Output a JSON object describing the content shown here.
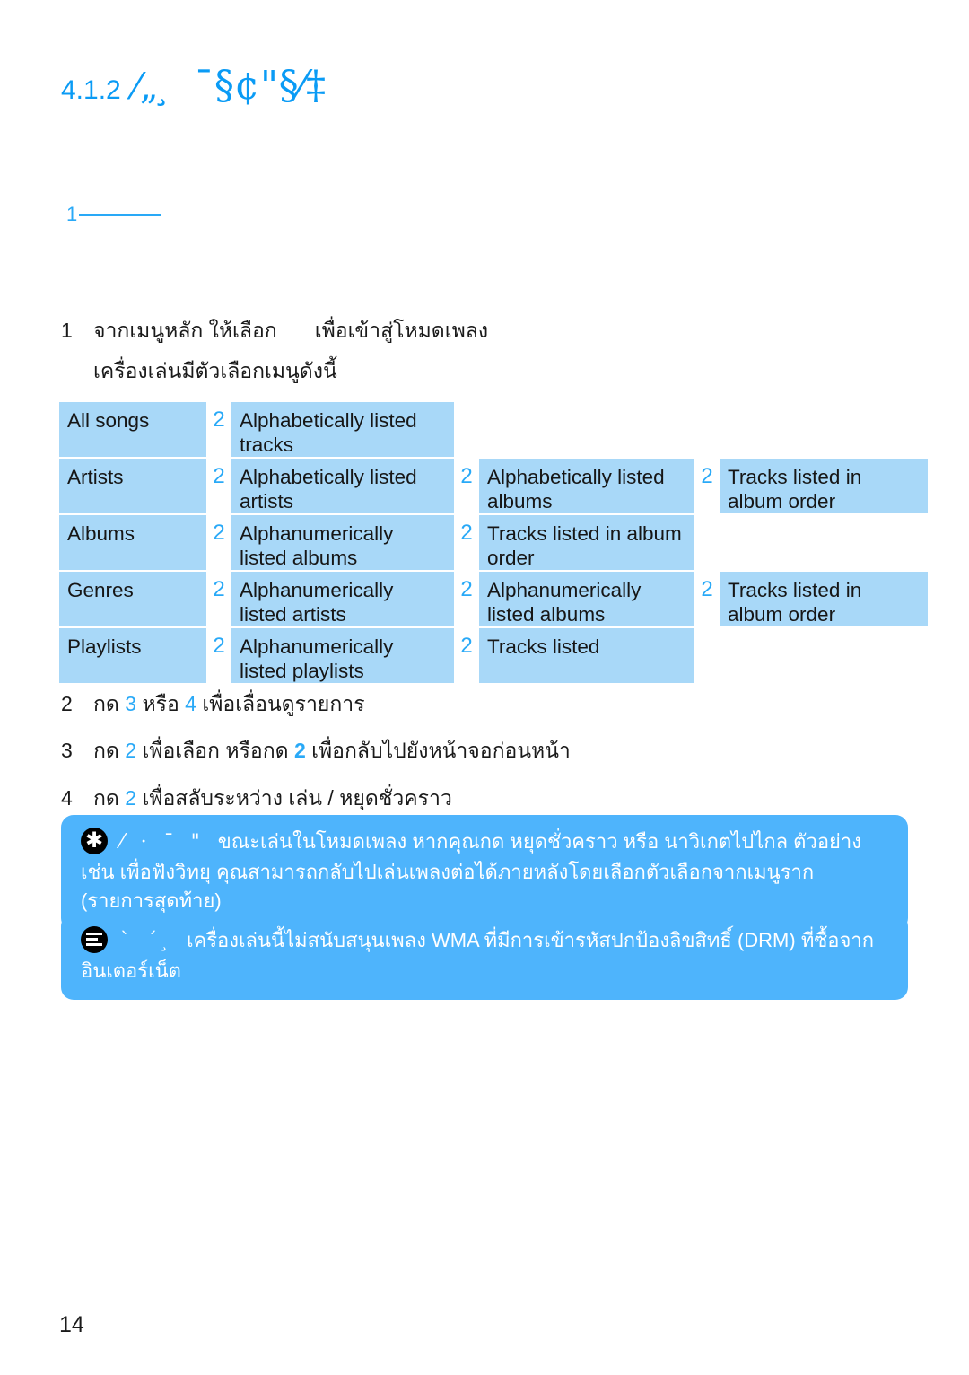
{
  "document": {
    "heading_number": "4.1.2",
    "heading_glyphs_1": "⁄„ ̧",
    "heading_glyphs_2": "¯§¢\"§⁄‡",
    "page_number": "14",
    "accent_blue": "#29a9f7",
    "cell_blue": "#a8d8f8",
    "notice_blue": "#4eb4fc"
  },
  "callout": {
    "number": "1"
  },
  "steps_top": [
    {
      "number": "1",
      "text_before": "จากเมนูหลัก ให้เลือก",
      "text_after": "เพื่อเข้าสู่โหมดเพลง"
    }
  ],
  "intro_line": "เครื่องเล่นมีตัวเลือกเมนูดังนี้",
  "menu_table": {
    "arrow_glyph": "2",
    "rows": [
      {
        "level1": "All songs",
        "level2": "Alphabetically listed tracks",
        "level3": "",
        "level4": ""
      },
      {
        "level1": "Artists",
        "level2": "Alphabetically listed artists",
        "level3": "Alphabetically listed albums",
        "level4": "Tracks listed in album order"
      },
      {
        "level1": "Albums",
        "level2": "Alphanumerically listed albums",
        "level3": "Tracks listed in album order",
        "level4": ""
      },
      {
        "level1": "Genres",
        "level2": "Alphanumerically listed artists",
        "level3": "Alphanumerically listed albums",
        "level4": "Tracks listed in album order"
      },
      {
        "level1": "Playlists",
        "level2": "Alphanumerically listed playlists",
        "level3": "Tracks listed",
        "level4": ""
      }
    ]
  },
  "steps_bottom": [
    {
      "number": "2",
      "p1": "กด ",
      "k1": "3",
      "p2": " หรือ ",
      "k2": "4",
      "p3": " เพื่อเลื่อนดูรายการ"
    },
    {
      "number": "3",
      "p1": "กด ",
      "k1": "2",
      "p2": " เพื่อเลือก หรือกด ",
      "k2": "2",
      "p3": " เพื่อกลับไปยังหน้าจอก่อนหน้า"
    },
    {
      "number": "4",
      "p1": "กด ",
      "k1": "2",
      "p2": " เพื่อสลับระหว่าง เล่น / หยุดชั่วคราว",
      "k2": "",
      "p3": ""
    }
  ],
  "notices": [
    {
      "icon": "tip-asterisk-icon",
      "marks": "⁄ · ¯ \"",
      "text": "ขณะเล่นในโหมดเพลง หากคุณกด หยุดชั่วคราว หรือ นาวิเกตไปไกล ตัวอย่างเช่น เพื่อฟังวิทยุ คุณสามารถกลับไปเล่นเพลงต่อได้ภายหลังโดยเลือกตัวเลือกจากเมนูราก (รายการสุดท้าย)"
    },
    {
      "icon": "note-lines-icon",
      "marks": "` ´ ̧",
      "text": "เครื่องเล่นนี้ไม่สนับสนุนเพลง WMA ที่มีการเข้ารหัสปกป้องลิขสิทธิ์ (DRM) ที่ซื้อจากอินเตอร์เน็ต"
    }
  ]
}
